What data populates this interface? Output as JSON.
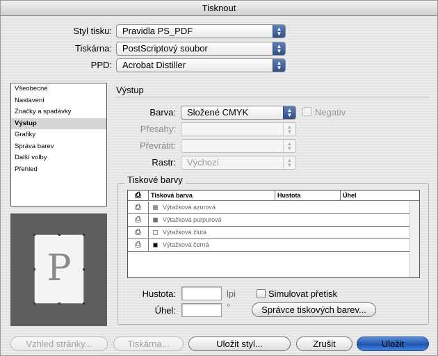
{
  "window": {
    "title": "Tisknout"
  },
  "top_fields": {
    "style_label": "Styl tisku:",
    "style_value": "Pravidla PS_PDF",
    "printer_label": "Tiskárna:",
    "printer_value": "PostScriptový soubor",
    "ppd_label": "PPD:",
    "ppd_value": "Acrobat Distiller"
  },
  "sidebar": {
    "items": [
      {
        "label": "Všeobecné",
        "selected": false
      },
      {
        "label": "Nastavení",
        "selected": false
      },
      {
        "label": "Značky a spadávky",
        "selected": false
      },
      {
        "label": "Výstup",
        "selected": true
      },
      {
        "label": "Grafiky",
        "selected": false
      },
      {
        "label": "Správa barev",
        "selected": false
      },
      {
        "label": "Další volby",
        "selected": false
      },
      {
        "label": "Přehled",
        "selected": false
      }
    ]
  },
  "preview": {
    "letter": "P"
  },
  "output": {
    "section_title": "Výstup",
    "color_label": "Barva:",
    "color_value": "Složené CMYK",
    "negative_label": "Negativ",
    "negative_checked": false,
    "trapping_label": "Přesahy:",
    "trapping_value": "",
    "flip_label": "Převrátit:",
    "flip_value": "",
    "screen_label": "Rastr:",
    "screen_value": "Výchozí"
  },
  "inks": {
    "group_title": "Tiskové barvy",
    "columns": [
      "Tisková barva",
      "Hustota",
      "Úhel"
    ],
    "rows": [
      {
        "name": "Výtažková azurová",
        "swatch": "#9a9a9a"
      },
      {
        "name": "Výtažková purpurová",
        "swatch": "#6e6e6e"
      },
      {
        "name": "Výtažková žlutá",
        "swatch": "#f0f0f0"
      },
      {
        "name": "Výtažková černá",
        "swatch": "#111111"
      }
    ],
    "frequency_label": "Hustota:",
    "frequency_value": "",
    "frequency_unit": "lpi",
    "angle_label": "Úhel:",
    "angle_value": "",
    "angle_unit": "°",
    "simulate_label": "Simulovat přetisk",
    "simulate_checked": false,
    "ink_manager_label": "Správce tiskových barev..."
  },
  "buttons": {
    "page_setup": "Vzhled stránky...",
    "printer": "Tiskárna...",
    "save_style": "Uložit styl...",
    "cancel": "Zrušit",
    "save": "Uložit"
  }
}
